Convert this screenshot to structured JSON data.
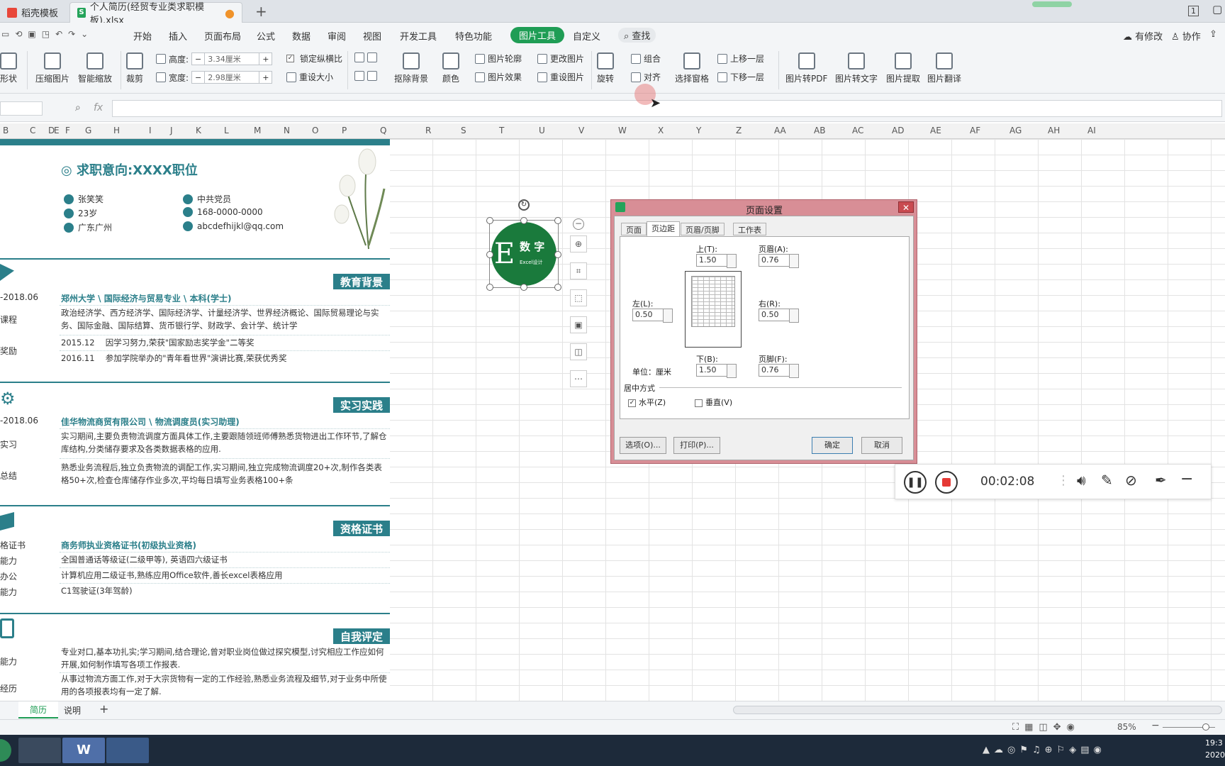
{
  "tabs": {
    "tab1": "稻壳模板",
    "tab2": "个人简历(经贸专业类求职模板).xlsx",
    "page_num": "1"
  },
  "menu": [
    "开始",
    "插入",
    "页面布局",
    "公式",
    "数据",
    "审阅",
    "视图",
    "开发工具",
    "特色功能",
    "图片工具",
    "自定义",
    "查找"
  ],
  "menu_right": {
    "edit": "有修改",
    "collab": "协作",
    "share": "分享"
  },
  "ribbon": {
    "shape": "形状",
    "compress": "压缩图片",
    "smart_zoom": "智能缩放",
    "crop": "裁剪",
    "height_label": "高度:",
    "height_value": "3.34厘米",
    "width_label": "宽度:",
    "width_value": "2.98厘米",
    "lock_ratio": "锁定纵横比",
    "reset_size": "重设大小",
    "remove_bg": "抠除背景",
    "color": "颜色",
    "outline": "图片轮廓",
    "effect": "图片效果",
    "change_pic": "更改图片",
    "reset_pic": "重设图片",
    "rotate": "旋转",
    "group": "组合",
    "align": "对齐",
    "select_pane": "选择窗格",
    "bring_up": "上移一层",
    "send_down": "下移一层",
    "to_pdf": "图片转PDF",
    "to_text": "图片转文字",
    "extract": "图片提取",
    "translate": "图片翻译"
  },
  "formula": {
    "fx": "fx"
  },
  "columns": [
    "B",
    "C",
    "D",
    "E",
    "F",
    "G",
    "H",
    "I",
    "J",
    "K",
    "L",
    "M",
    "N",
    "O",
    "P",
    "Q",
    "R",
    "S",
    "T",
    "U",
    "V",
    "W",
    "X",
    "Y",
    "Z",
    "AA",
    "AB",
    "AC",
    "AD",
    "AE",
    "AF",
    "AG",
    "AH",
    "AI"
  ],
  "resume": {
    "intent": "求职意向:XXXX职位",
    "name": "张笑笑",
    "party": "中共党员",
    "age": "23岁",
    "phone": "168-0000-0000",
    "city": "广东广州",
    "email": "abcdefhijkl@qq.com",
    "edu_title": "教育背景",
    "edu_date": "-2018.06",
    "edu_school": "郑州大学 \\ 国际经济与贸易专业 \\ 本科(学士)",
    "edu_course_label": "课程",
    "edu_course": "政治经济学、西方经济学、国际经济学、计量经济学、世界经济概论、国际贸易理论与实务、国际金融、国际结算、货币银行学、财政学、会计学、统计学",
    "edu_award_label": "奖励",
    "edu_award1": "2015.12　 因学习努力,荣获\"国家励志奖学金\"二等奖",
    "edu_award2": "2016.11　 参加学院举办的\"青年看世界\"演讲比赛,荣获优秀奖",
    "prac_title": "实习实践",
    "prac_date": "-2018.06",
    "prac_company": "佳华物流商贸有限公司 \\ 物流调度员(实习助理)",
    "prac_label1": "实习",
    "prac_text1": "实习期间,主要负责物流调度方面具体工作,主要跟随领班师傅熟悉货物进出工作环节,了解仓库结构,分类储存要求及各类数据表格的应用.",
    "prac_label2": "总结",
    "prac_text2": "熟悉业务流程后,独立负责物流的调配工作,实习期间,独立完成物流调度20+次,制作各类表格50+次,检查仓库储存作业多次,平均每日填写业务表格100+条",
    "cert_title": "资格证书",
    "cert_label1": "格证书",
    "cert_text1": "商务师执业资格证书(初级执业资格)",
    "cert_label2": "能力",
    "cert_text2": "全国普通话等级证(二级甲等), 英语四六级证书",
    "cert_label3": "办公",
    "cert_text3": "计算机应用二级证书,熟练应用Office软件,善长excel表格应用",
    "cert_label4": "能力",
    "cert_text4": "C1驾驶证(3年驾龄)",
    "self_title": "自我评定",
    "self_label1": "能力",
    "self_text1": "专业对口,基本功扎实;学习期间,结合理论,曾对职业岗位做过探究模型,讨究相应工作应如何开展,如何制作填写各项工作报表.",
    "self_label2": "经历",
    "self_text2": "从事过物流方面工作,对于大宗货物有一定的工作经验,熟悉业务流程及细节,对于业务中所使用的各项报表均有一定了解."
  },
  "logo": {
    "letter": "E",
    "text": "数 字",
    "sub": "Excel设计",
    "color": "#1a7a3c"
  },
  "dialog": {
    "title": "页面设置",
    "tab1": "页面",
    "tab2": "页边距",
    "tab3": "页眉/页脚",
    "tab4": "工作表",
    "top_label": "上(T):",
    "top_value": "1.50",
    "header_label": "页眉(A):",
    "header_value": "0.76",
    "left_label": "左(L):",
    "left_value": "0.50",
    "right_label": "右(R):",
    "right_value": "0.50",
    "bottom_label": "下(B):",
    "bottom_value": "1.50",
    "footer_label": "页脚(F):",
    "footer_value": "0.76",
    "unit": "单位：厘米",
    "center_label": "居中方式",
    "horizontal": "水平(Z)",
    "vertical": "垂直(V)",
    "options_btn": "选项(O)...",
    "print_btn": "打印(P)...",
    "ok_btn": "确定",
    "cancel_btn": "取消"
  },
  "recorder": {
    "time": "00:02:08"
  },
  "sheettabs": {
    "tab1": "简历",
    "tab2": "说明"
  },
  "status": {
    "zoom": "85%"
  },
  "taskbar": {
    "clock": "19:3",
    "year": "2020"
  }
}
